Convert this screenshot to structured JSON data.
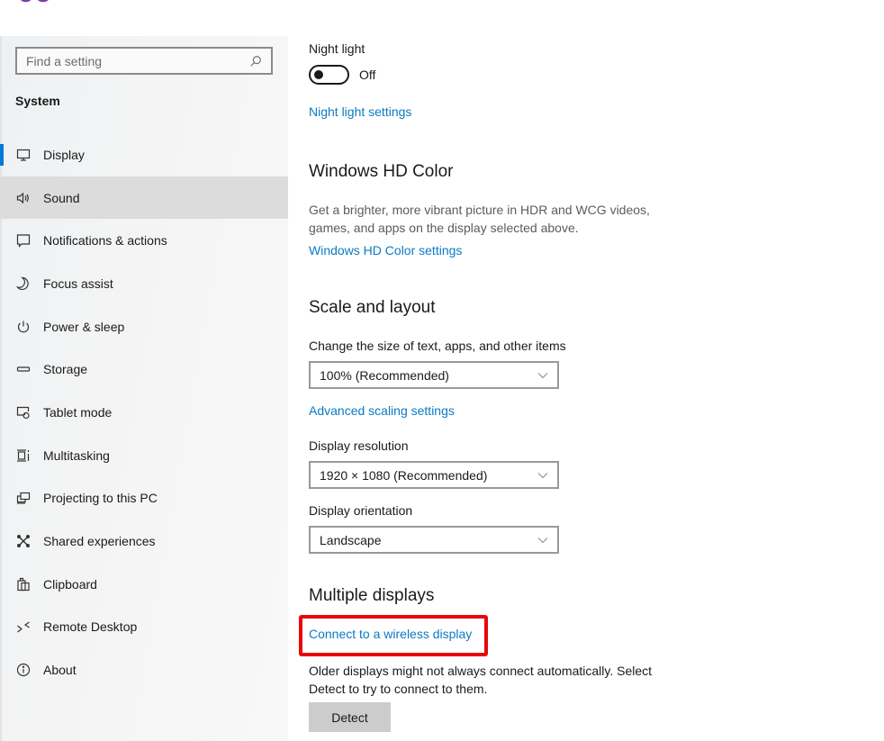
{
  "sidebar": {
    "search_placeholder": "Find a setting",
    "heading": "System",
    "items": [
      {
        "label": "Display",
        "icon": "monitor-icon",
        "active": true
      },
      {
        "label": "Sound",
        "icon": "speaker-icon",
        "hover": true
      },
      {
        "label": "Notifications & actions",
        "icon": "notification-icon"
      },
      {
        "label": "Focus assist",
        "icon": "moon-icon"
      },
      {
        "label": "Power & sleep",
        "icon": "power-icon"
      },
      {
        "label": "Storage",
        "icon": "storage-icon"
      },
      {
        "label": "Tablet mode",
        "icon": "tablet-mode-icon"
      },
      {
        "label": "Multitasking",
        "icon": "multitasking-icon"
      },
      {
        "label": "Projecting to this PC",
        "icon": "projecting-icon"
      },
      {
        "label": "Shared experiences",
        "icon": "shared-experiences-icon"
      },
      {
        "label": "Clipboard",
        "icon": "clipboard-icon"
      },
      {
        "label": "Remote Desktop",
        "icon": "remote-desktop-icon"
      },
      {
        "label": "About",
        "icon": "info-icon"
      }
    ]
  },
  "main": {
    "night_light": {
      "label": "Night light",
      "toggle_state": "Off",
      "toggle_on": false,
      "settings_link": "Night light settings"
    },
    "hd_color": {
      "heading": "Windows HD Color",
      "description": "Get a brighter, more vibrant picture in HDR and WCG videos, games, and apps on the display selected above.",
      "settings_link": "Windows HD Color settings"
    },
    "scale_layout": {
      "heading": "Scale and layout",
      "scale_label": "Change the size of text, apps, and other items",
      "scale_value": "100% (Recommended)",
      "advanced_link": "Advanced scaling settings",
      "resolution_label": "Display resolution",
      "resolution_value": "1920 × 1080 (Recommended)",
      "orientation_label": "Display orientation",
      "orientation_value": "Landscape"
    },
    "multiple_displays": {
      "heading": "Multiple displays",
      "wireless_link": "Connect to a wireless display",
      "description": "Older displays might not always connect automatically. Select Detect to try to connect to them.",
      "detect_button": "Detect"
    }
  },
  "colors": {
    "accent": "#0078d7",
    "link": "#0b7ac4",
    "highlight": "#e8060b"
  }
}
